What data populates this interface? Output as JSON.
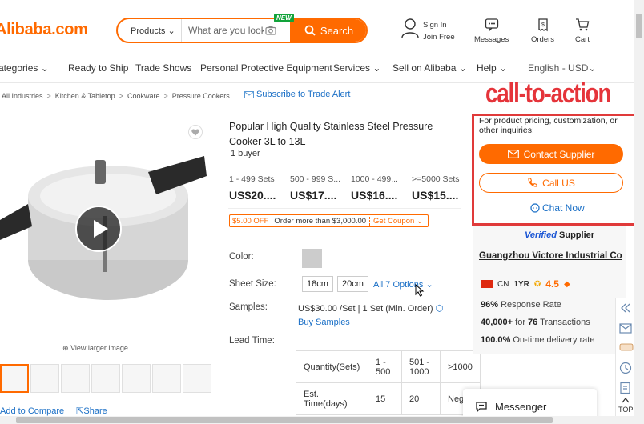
{
  "header": {
    "logo": "Alibaba.com",
    "search": {
      "category": "Products",
      "placeholder": "What are you looki",
      "button": "Search",
      "new_badge": "NEW"
    },
    "signin": {
      "line1": "Sign In",
      "line2": "Join Free"
    },
    "icons": [
      {
        "label": "Messages",
        "icon": "messages-icon"
      },
      {
        "label": "Orders",
        "icon": "orders-icon"
      },
      {
        "label": "Cart",
        "icon": "cart-icon"
      }
    ]
  },
  "nav": {
    "items": [
      "ategories",
      "Ready to Ship",
      "Trade Shows",
      "Personal Protective Equipment",
      "Services",
      "Sell on Alibaba",
      "Help",
      "English - USD"
    ]
  },
  "breadcrumb": {
    "items": [
      "All Industries",
      "Kitchen & Tabletop",
      "Cookware",
      "Pressure Cookers"
    ],
    "trade_alert": "Subscribe to Trade Alert"
  },
  "product": {
    "title": "Popular High Quality Stainless Steel Pressure Cooker 3L to 13L",
    "buyers": "1 buyer",
    "tiers": [
      {
        "qty": "1 - 499 Sets",
        "price": "US$20...."
      },
      {
        "qty": "500 - 999 S...",
        "price": "US$17...."
      },
      {
        "qty": "1000 - 499...",
        "price": "US$16...."
      },
      {
        "qty": ">=5000 Sets",
        "price": "US$15...."
      }
    ],
    "coupon": {
      "off": "$5.00 OFF",
      "condition": "Order more than $3,000.00",
      "get": "Get Coupon"
    },
    "labels": {
      "color": "Color:",
      "size": "Sheet Size:",
      "samples": "Samples:",
      "lead": "Lead Time:"
    },
    "sizes": [
      "18cm",
      "20cm"
    ],
    "all_options": "All 7 Options",
    "samples_value": "US$30.00 /Set  |  1 Set (Min. Order)",
    "buy_samples": "Buy Samples",
    "lead_table": {
      "rows": [
        [
          "Quantity(Sets)",
          "1 - 500",
          "501 - 1000",
          ">1000"
        ],
        [
          "Est. Time(days)",
          "15",
          "20",
          "Nego"
        ]
      ]
    },
    "view_larger": "View larger image",
    "add_compare": "Add to Compare",
    "share": "Share",
    "thumb_count": 7
  },
  "cta": {
    "annotation": "call-to-action",
    "text": "For product pricing, customization, or other inquiries:",
    "contact": "Contact Supplier",
    "call": "Call US",
    "chat": "Chat Now"
  },
  "supplier": {
    "verified_prefix": "Verified",
    "verified_suffix": "Supplier",
    "name": "Guangzhou Victore Industrial Co.,...",
    "country": "CN",
    "years": "1YR",
    "rating": "4.5",
    "stats": [
      {
        "value": "96%",
        "text": "Response Rate"
      },
      {
        "value": "40,000+",
        "text": "for",
        "extra": "76",
        "tail": "Transactions"
      },
      {
        "value": "100.0%",
        "text": "On-time delivery rate"
      }
    ]
  },
  "sidebar": {
    "top_label": "TOP"
  },
  "messenger": {
    "label": "Messenger"
  },
  "colors": {
    "accent": "#ff6a00",
    "link": "#1a6fc6",
    "annotation": "#e03a3a"
  }
}
